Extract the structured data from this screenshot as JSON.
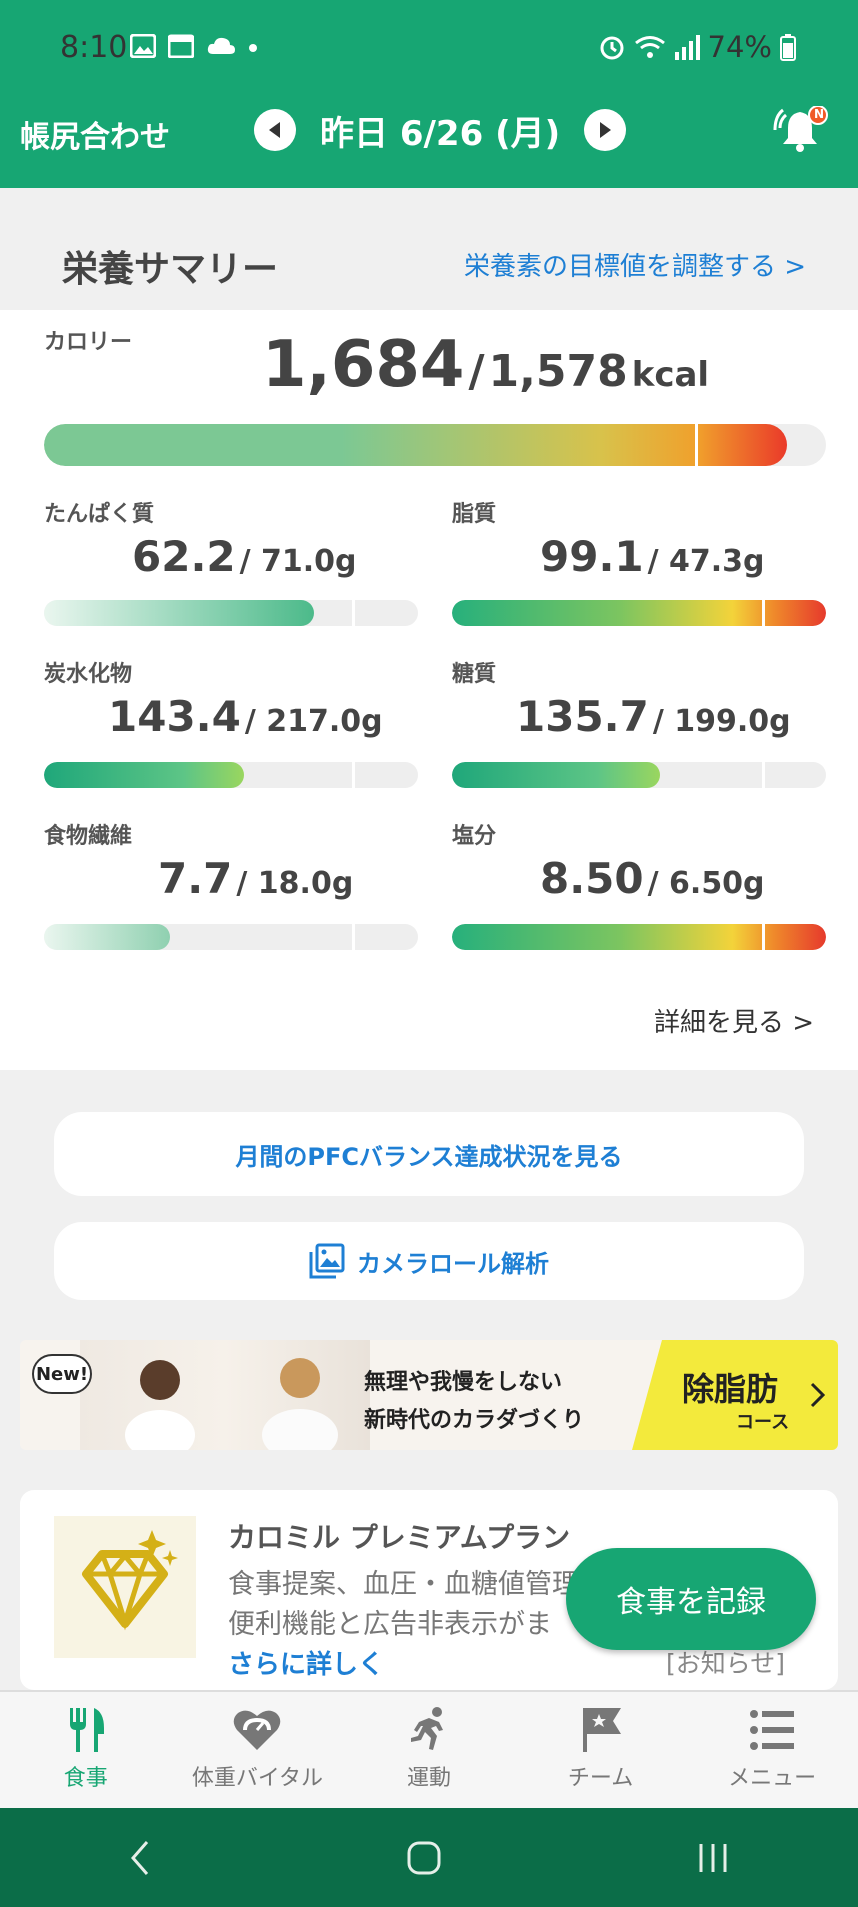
{
  "status_bar": {
    "time": "8:10",
    "battery": "74%"
  },
  "header": {
    "title": "帳尻合わせ",
    "date": "昨日 6/26 (月)",
    "badge": "N"
  },
  "summary": {
    "title": "栄養サマリー",
    "adjust_link": "栄養素の目標値を調整する >"
  },
  "calories": {
    "label": "カロリー",
    "value": "1,684",
    "slash": "/",
    "goal": "1,578",
    "unit": "kcal",
    "fraction": 1.067
  },
  "nutrients": [
    {
      "label": "たんぱく質",
      "value": "62.2",
      "goal": "/ 71.0g",
      "fraction": 0.876
    },
    {
      "label": "脂質",
      "value": "99.1",
      "goal": "/ 47.3g",
      "fraction": 2.09
    },
    {
      "label": "炭水化物",
      "value": "143.4",
      "goal": "/ 217.0g",
      "fraction": 0.661
    },
    {
      "label": "糖質",
      "value": "135.7",
      "goal": "/ 199.0g",
      "fraction": 0.682
    },
    {
      "label": "食物繊維",
      "value": "7.7",
      "goal": "/ 18.0g",
      "fraction": 0.428
    },
    {
      "label": "塩分",
      "value": "8.50",
      "goal": "/ 6.50g",
      "fraction": 1.31
    }
  ],
  "detail_link": "詳細を見る >",
  "buttons": {
    "pfc": "月間のPFCバランス達成状況を見る",
    "camera": "カメラロール解析"
  },
  "banner": {
    "new": "New!",
    "line1": "無理や我慢をしない",
    "line2": "新時代のカラダづくり",
    "badge_main": "除脂肪",
    "badge_sub": "コース"
  },
  "premium": {
    "title": "カロミル プレミアムプラン",
    "line1": "食事提案、血圧・血糖値管理",
    "line2": "便利機能と広告非表示がま",
    "more": "さらに詳しく",
    "notice": "[お知らせ]"
  },
  "fab": "食事を記録",
  "tabs": [
    {
      "label": "食事",
      "icon": "fork-knife-icon"
    },
    {
      "label": "体重バイタル",
      "icon": "heart-gauge-icon"
    },
    {
      "label": "運動",
      "icon": "runner-icon"
    },
    {
      "label": "チーム",
      "icon": "flag-icon"
    },
    {
      "label": "メニュー",
      "icon": "list-icon"
    }
  ],
  "colors": {
    "brand": "#17a673",
    "link": "#1e7fd4",
    "nav": "#0b6d48"
  }
}
